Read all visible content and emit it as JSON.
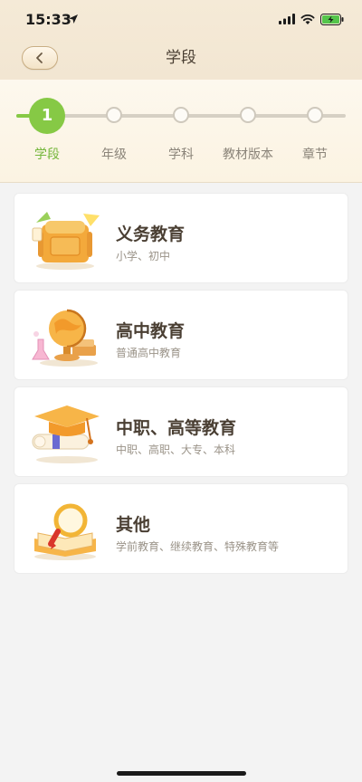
{
  "status": {
    "time": "15:33"
  },
  "nav": {
    "title": "学段",
    "back_icon": "chevron-left-icon"
  },
  "stepper": {
    "active_index": 0,
    "current_number": "1",
    "steps": [
      "学段",
      "年级",
      "学科",
      "教材版本",
      "章节"
    ]
  },
  "items": [
    {
      "title": "义务教育",
      "subtitle": "小学、初中",
      "icon": "backpack-icon"
    },
    {
      "title": "高中教育",
      "subtitle": "普通高中教育",
      "icon": "globe-icon"
    },
    {
      "title": "中职、高等教育",
      "subtitle": "中职、高职、大专、本科",
      "icon": "graduation-cap-icon"
    },
    {
      "title": "其他",
      "subtitle": "学前教育、继续教育、特殊教育等",
      "icon": "magnifier-book-icon"
    }
  ],
  "colors": {
    "accent": "#86c945",
    "header_bg": "#f5ead7",
    "background": "#f3f3f3"
  }
}
